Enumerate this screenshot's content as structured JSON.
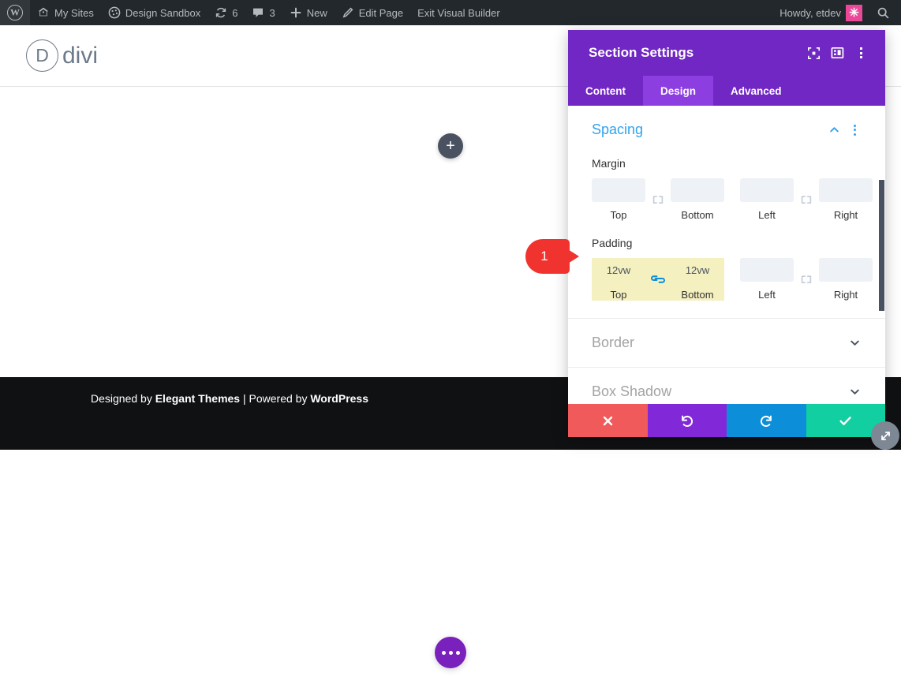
{
  "admin_bar": {
    "items": [
      {
        "icon": "wordpress-logo-icon",
        "label": ""
      },
      {
        "icon": "sites-icon",
        "label": "My Sites"
      },
      {
        "icon": "site-icon",
        "label": "Design Sandbox"
      },
      {
        "icon": "updates-icon",
        "label": "6"
      },
      {
        "icon": "comments-icon",
        "label": "3"
      },
      {
        "icon": "plus-icon",
        "label": "New"
      },
      {
        "icon": "pencil-icon",
        "label": "Edit Page"
      },
      {
        "icon": "",
        "label": "Exit Visual Builder"
      }
    ],
    "howdy": "Howdy, etdev",
    "avatar_glyph": "✳",
    "search_icon": "search-icon"
  },
  "site_header": {
    "logo_mark": "D",
    "logo_word": "divi"
  },
  "canvas": {
    "add_section_glyph": "+",
    "page_settings_glyph": "•••"
  },
  "footer": {
    "credit_prefix": "Designed by ",
    "credit_brand": "Elegant Themes",
    "credit_middle": " | Powered by ",
    "credit_platform": "WordPress"
  },
  "modal": {
    "title": "Section Settings",
    "header_icons": [
      "focus-frame-icon",
      "layout-panel-icon",
      "kebab-menu-icon"
    ],
    "tabs": [
      {
        "label": "Content",
        "active": false
      },
      {
        "label": "Design",
        "active": true
      },
      {
        "label": "Advanced",
        "active": false
      }
    ],
    "sections": [
      {
        "title": "Spacing",
        "state": "open"
      },
      {
        "title": "Border",
        "state": "closed"
      },
      {
        "title": "Box Shadow",
        "state": "closed"
      }
    ],
    "spacing": {
      "margin": {
        "label": "Margin",
        "top": {
          "value": "",
          "placeholder": "",
          "caption": "Top"
        },
        "bottom": {
          "value": "",
          "placeholder": "",
          "caption": "Bottom"
        },
        "left": {
          "value": "",
          "placeholder": "",
          "caption": "Left"
        },
        "right": {
          "value": "",
          "placeholder": "",
          "caption": "Right"
        },
        "link_tb": "unlinked-icon",
        "link_lr": "unlinked-icon",
        "highlight": false
      },
      "padding": {
        "label": "Padding",
        "top": {
          "value": "12vw",
          "placeholder": "",
          "caption": "Top"
        },
        "bottom": {
          "value": "12vw",
          "placeholder": "",
          "caption": "Bottom"
        },
        "left": {
          "value": "",
          "placeholder": "",
          "caption": "Left"
        },
        "right": {
          "value": "",
          "placeholder": "",
          "caption": "Right"
        },
        "link_tb": "linked-icon",
        "link_lr": "unlinked-icon",
        "highlight": true
      }
    },
    "actions": [
      {
        "name": "discard",
        "glyph": "✖",
        "color": "#f15a5a"
      },
      {
        "name": "undo",
        "glyph": "↺",
        "color": "#8129d9"
      },
      {
        "name": "redo",
        "glyph": "↻",
        "color": "#0c8ed9"
      },
      {
        "name": "save",
        "glyph": "✔",
        "color": "#12cfa1"
      }
    ],
    "resize_icon": "resize-handle-icon"
  },
  "annotations": [
    {
      "number": "1",
      "color": "#f0332f"
    }
  ]
}
